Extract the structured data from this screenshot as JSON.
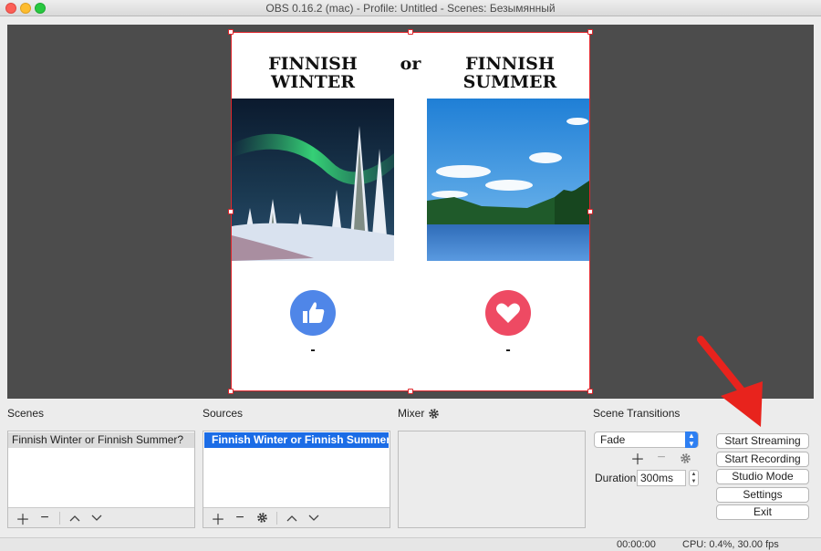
{
  "window": {
    "title": "OBS 0.16.2 (mac) - Profile: Untitled - Scenes: Безымянный"
  },
  "preview": {
    "left_title": "FINNISH\nWINTER",
    "right_title": "FINNISH\nSUMMER",
    "or_text": "or",
    "left_count": "-",
    "right_count": "-",
    "left_icon": "thumbs-up-icon",
    "right_icon": "heart-icon",
    "accent_like": "#4f86e8",
    "accent_heart": "#ee4a63",
    "selection_color": "#e0262c"
  },
  "scenes": {
    "label": "Scenes",
    "items": [
      "Finnish Winter or Finnish Summer?"
    ]
  },
  "sources": {
    "label": "Sources",
    "items": [
      "Finnish Winter or Finnish Summer"
    ]
  },
  "mixer": {
    "label": "Mixer"
  },
  "transitions": {
    "label": "Scene Transitions",
    "selected": "Fade",
    "duration_label": "Duration",
    "duration_value": "300ms"
  },
  "controls": {
    "start_streaming": "Start Streaming",
    "start_recording": "Start Recording",
    "studio_mode": "Studio Mode",
    "settings": "Settings",
    "exit": "Exit"
  },
  "status": {
    "time": "00:00:00",
    "cpu": "CPU: 0.4%, 30.00 fps"
  }
}
